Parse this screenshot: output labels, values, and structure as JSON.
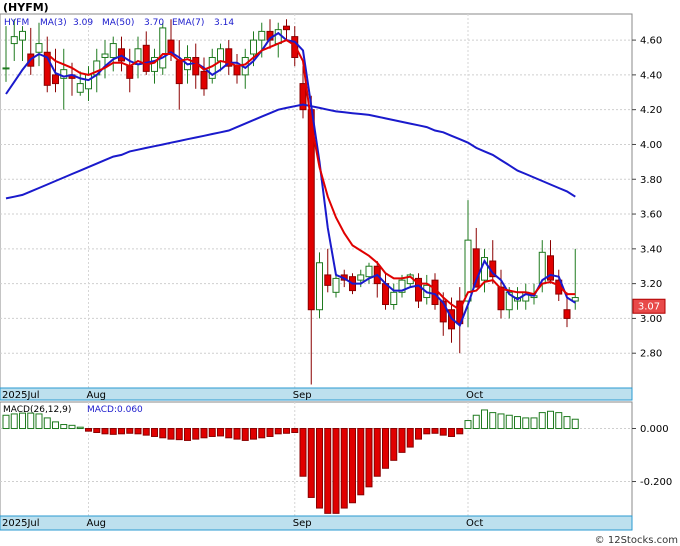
{
  "header": {
    "title": "(HYFM)"
  },
  "footer": {
    "credit": "© 12Stocks.com"
  },
  "colors": {
    "up_candle": "#ffffff",
    "down_candle": "#e00000",
    "ma3": "#1a1acc",
    "ma50": "#1a1acc",
    "ema7": "#e00000",
    "macd_bar": "#e00000",
    "band": "#bde0ee",
    "frame": "#2a9ad0"
  },
  "chart_data": [
    {
      "type": "line",
      "title": "",
      "legend": {
        "symbol": "HYFM",
        "items": [
          {
            "label": "MA(3)",
            "value": "3.09",
            "color": "#1a1acc"
          },
          {
            "label": "MA(50)",
            "value": "3.70",
            "color": "#1a1acc"
          },
          {
            "label": "EMA(7)",
            "value": "3.14",
            "color": "#e00000"
          }
        ]
      },
      "last_price_label": "3.07",
      "ylim": [
        2.6,
        4.75
      ],
      "y_ticks": [
        "4.60",
        "4.40",
        "4.20",
        "4.00",
        "3.80",
        "3.60",
        "3.40",
        "3.20",
        "3.00",
        "2.80"
      ],
      "x_ticks": [
        {
          "label": "2025Jul",
          "index": 0
        },
        {
          "label": "Aug",
          "index": 10
        },
        {
          "label": "Sep",
          "index": 35
        },
        {
          "label": "Oct",
          "index": 56
        }
      ],
      "candles": [
        [
          4.44,
          4.68,
          4.36,
          4.44
        ],
        [
          4.58,
          4.72,
          4.48,
          4.62
        ],
        [
          4.6,
          4.68,
          4.48,
          4.65
        ],
        [
          4.52,
          4.67,
          4.4,
          4.45
        ],
        [
          4.53,
          4.7,
          4.45,
          4.58
        ],
        [
          4.53,
          4.62,
          4.3,
          4.34
        ],
        [
          4.4,
          4.55,
          4.3,
          4.35
        ],
        [
          4.38,
          4.55,
          4.2,
          4.43
        ],
        [
          4.4,
          4.47,
          4.28,
          4.38
        ],
        [
          4.3,
          4.42,
          4.28,
          4.35
        ],
        [
          4.32,
          4.45,
          4.25,
          4.4
        ],
        [
          4.4,
          4.55,
          4.3,
          4.48
        ],
        [
          4.5,
          4.6,
          4.38,
          4.52
        ],
        [
          4.5,
          4.62,
          4.42,
          4.58
        ],
        [
          4.55,
          4.62,
          4.42,
          4.48
        ],
        [
          4.45,
          4.55,
          4.3,
          4.38
        ],
        [
          4.46,
          4.62,
          4.38,
          4.55
        ],
        [
          4.57,
          4.65,
          4.4,
          4.42
        ],
        [
          4.42,
          4.55,
          4.35,
          4.5
        ],
        [
          4.44,
          4.7,
          4.4,
          4.67
        ],
        [
          4.6,
          4.72,
          4.48,
          4.52
        ],
        [
          4.48,
          4.6,
          4.2,
          4.35
        ],
        [
          4.43,
          4.57,
          4.35,
          4.5
        ],
        [
          4.5,
          4.58,
          4.32,
          4.4
        ],
        [
          4.42,
          4.5,
          4.28,
          4.32
        ],
        [
          4.38,
          4.55,
          4.35,
          4.5
        ],
        [
          4.48,
          4.58,
          4.42,
          4.55
        ],
        [
          4.55,
          4.6,
          4.4,
          4.45
        ],
        [
          4.45,
          4.52,
          4.35,
          4.4
        ],
        [
          4.4,
          4.55,
          4.32,
          4.5
        ],
        [
          4.52,
          4.65,
          4.45,
          4.6
        ],
        [
          4.6,
          4.7,
          4.5,
          4.65
        ],
        [
          4.65,
          4.72,
          4.55,
          4.6
        ],
        [
          4.58,
          4.7,
          4.5,
          4.66
        ],
        [
          4.68,
          4.72,
          4.6,
          4.66
        ],
        [
          4.62,
          4.68,
          4.45,
          4.5
        ],
        [
          4.35,
          4.45,
          4.15,
          4.2
        ],
        [
          4.2,
          4.28,
          2.62,
          3.05
        ],
        [
          3.05,
          3.38,
          3.0,
          3.32
        ],
        [
          3.25,
          3.4,
          3.15,
          3.19
        ],
        [
          3.15,
          3.25,
          3.12,
          3.23
        ],
        [
          3.25,
          3.28,
          3.18,
          3.22
        ],
        [
          3.24,
          3.26,
          3.14,
          3.16
        ],
        [
          3.22,
          3.28,
          3.18,
          3.25
        ],
        [
          3.24,
          3.32,
          3.2,
          3.3
        ],
        [
          3.3,
          3.33,
          3.12,
          3.2
        ],
        [
          3.2,
          3.26,
          3.05,
          3.08
        ],
        [
          3.08,
          3.2,
          3.05,
          3.15
        ],
        [
          3.15,
          3.25,
          3.12,
          3.22
        ],
        [
          3.2,
          3.26,
          3.18,
          3.25
        ],
        [
          3.23,
          3.26,
          3.06,
          3.1
        ],
        [
          3.12,
          3.25,
          3.08,
          3.19
        ],
        [
          3.22,
          3.26,
          3.05,
          3.08
        ],
        [
          3.1,
          3.15,
          2.9,
          2.98
        ],
        [
          3.05,
          3.12,
          2.86,
          2.94
        ],
        [
          3.1,
          3.18,
          2.8,
          2.97
        ],
        [
          3.1,
          3.68,
          2.95,
          3.45
        ],
        [
          3.4,
          3.52,
          3.18,
          3.18
        ],
        [
          3.22,
          3.4,
          3.15,
          3.35
        ],
        [
          3.33,
          3.45,
          3.2,
          3.24
        ],
        [
          3.18,
          3.28,
          3.0,
          3.05
        ],
        [
          3.05,
          3.18,
          3.0,
          3.15
        ],
        [
          3.1,
          3.18,
          3.05,
          3.12
        ],
        [
          3.1,
          3.2,
          3.05,
          3.15
        ],
        [
          3.12,
          3.2,
          3.08,
          3.13
        ],
        [
          3.2,
          3.45,
          3.15,
          3.38
        ],
        [
          3.36,
          3.45,
          3.2,
          3.22
        ],
        [
          3.22,
          3.28,
          3.1,
          3.14
        ],
        [
          3.05,
          3.15,
          2.95,
          3.0
        ],
        [
          3.1,
          3.4,
          3.05,
          3.12
        ]
      ],
      "series": [
        {
          "name": "MA(3)",
          "values": [
            4.29,
            4.36,
            4.43,
            4.49,
            4.52,
            4.5,
            4.41,
            4.39,
            4.4,
            4.38,
            4.37,
            4.4,
            4.45,
            4.49,
            4.51,
            4.48,
            4.46,
            4.47,
            4.48,
            4.5,
            4.53,
            4.5,
            4.46,
            4.47,
            4.44,
            4.4,
            4.43,
            4.47,
            4.47,
            4.44,
            4.48,
            4.54,
            4.61,
            4.64,
            4.6,
            4.59,
            4.54,
            4.22,
            3.9,
            3.52,
            3.25,
            3.23,
            3.2,
            3.2,
            3.23,
            3.25,
            3.2,
            3.16,
            3.16,
            3.18,
            3.19,
            3.15,
            3.14,
            3.09,
            3.0,
            2.96,
            3.08,
            3.22,
            3.33,
            3.26,
            3.22,
            3.14,
            3.11,
            3.14,
            3.13,
            3.22,
            3.25,
            3.24,
            3.12,
            3.09
          ]
        },
        {
          "name": "MA(50)",
          "values": [
            3.69,
            3.7,
            3.71,
            3.73,
            3.75,
            3.77,
            3.79,
            3.81,
            3.83,
            3.85,
            3.87,
            3.89,
            3.91,
            3.93,
            3.94,
            3.96,
            3.97,
            3.98,
            3.99,
            4.0,
            4.01,
            4.02,
            4.03,
            4.04,
            4.05,
            4.06,
            4.07,
            4.08,
            4.1,
            4.12,
            4.14,
            4.16,
            4.18,
            4.2,
            4.21,
            4.22,
            4.23,
            4.22,
            4.21,
            4.2,
            4.19,
            4.185,
            4.18,
            4.175,
            4.17,
            4.16,
            4.15,
            4.14,
            4.13,
            4.12,
            4.11,
            4.1,
            4.08,
            4.07,
            4.05,
            4.03,
            4.01,
            3.98,
            3.96,
            3.94,
            3.91,
            3.88,
            3.85,
            3.83,
            3.81,
            3.79,
            3.77,
            3.75,
            3.73,
            3.7
          ]
        },
        {
          "name": "EMA(7)",
          "values": [
            null,
            null,
            null,
            null,
            null,
            4.52,
            4.48,
            4.46,
            4.44,
            4.41,
            4.4,
            4.42,
            4.44,
            4.47,
            4.47,
            4.45,
            4.48,
            4.46,
            4.47,
            4.52,
            4.52,
            4.48,
            4.49,
            4.47,
            4.43,
            4.45,
            4.48,
            4.47,
            4.45,
            4.46,
            4.5,
            4.54,
            4.56,
            4.58,
            4.6,
            4.57,
            4.48,
            4.12,
            3.87,
            3.7,
            3.58,
            3.49,
            3.42,
            3.39,
            3.36,
            3.32,
            3.26,
            3.23,
            3.23,
            3.24,
            3.2,
            3.2,
            3.17,
            3.12,
            3.08,
            3.05,
            3.15,
            3.16,
            3.21,
            3.22,
            3.17,
            3.16,
            3.15,
            3.15,
            3.14,
            3.2,
            3.21,
            3.19,
            3.14,
            3.14
          ]
        }
      ]
    },
    {
      "type": "bar",
      "title": "",
      "legend": {
        "label": "MACD(26,12,9)",
        "value_label": "MACD:",
        "value": "0.060"
      },
      "ylim": [
        -0.33,
        0.1
      ],
      "y_ticks": [
        "0.000",
        "-0.200"
      ],
      "x_ticks": [
        {
          "label": "2025Jul",
          "index": 0
        },
        {
          "label": "Aug",
          "index": 10
        },
        {
          "label": "Sep",
          "index": 35
        },
        {
          "label": "Oct",
          "index": 56
        }
      ],
      "values": [
        0.05,
        0.055,
        0.058,
        0.058,
        0.055,
        0.04,
        0.025,
        0.015,
        0.012,
        0.005,
        -0.01,
        -0.015,
        -0.02,
        -0.022,
        -0.02,
        -0.018,
        -0.02,
        -0.025,
        -0.03,
        -0.035,
        -0.04,
        -0.042,
        -0.045,
        -0.04,
        -0.035,
        -0.03,
        -0.028,
        -0.035,
        -0.04,
        -0.045,
        -0.04,
        -0.035,
        -0.03,
        -0.02,
        -0.018,
        -0.015,
        -0.18,
        -0.26,
        -0.3,
        -0.32,
        -0.32,
        -0.3,
        -0.28,
        -0.25,
        -0.22,
        -0.18,
        -0.15,
        -0.12,
        -0.09,
        -0.07,
        -0.04,
        -0.02,
        -0.018,
        -0.025,
        -0.03,
        -0.02,
        0.03,
        0.05,
        0.07,
        0.06,
        0.055,
        0.05,
        0.045,
        0.04,
        0.04,
        0.06,
        0.065,
        0.06,
        0.045,
        0.035
      ]
    }
  ]
}
